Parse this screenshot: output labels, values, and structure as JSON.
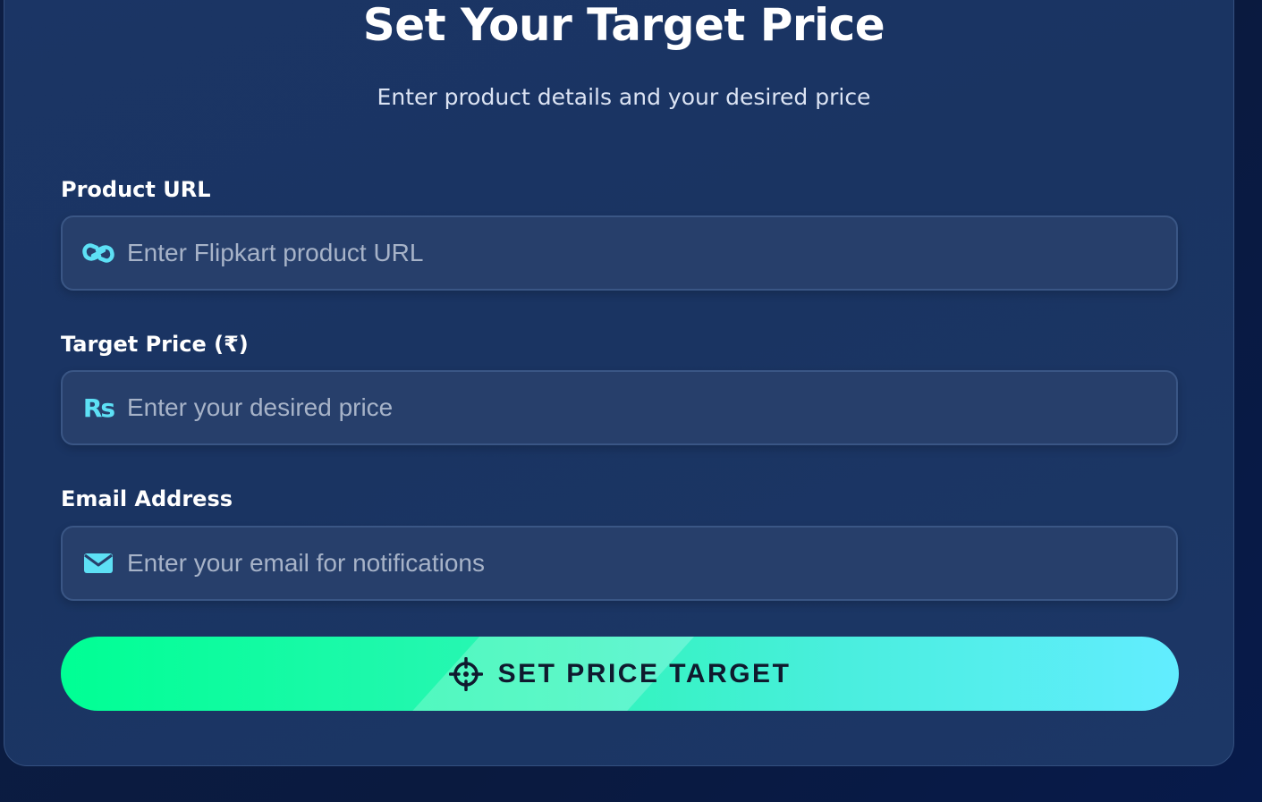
{
  "header": {
    "title": "Set Your Target Price",
    "subtitle": "Enter product details and your desired price"
  },
  "form": {
    "product_url": {
      "label": "Product URL",
      "placeholder": "Enter Flipkart product URL",
      "value": "",
      "icon": "link-icon"
    },
    "target_price": {
      "label": "Target Price (₹)",
      "placeholder": "Enter your desired price",
      "value": "",
      "icon": "rupee-icon",
      "icon_text": "Rs"
    },
    "email": {
      "label": "Email Address",
      "placeholder": "Enter your email for notifications",
      "value": "",
      "icon": "envelope-icon"
    },
    "submit": {
      "label": "SET PRICE TARGET",
      "icon": "crosshairs-icon"
    }
  },
  "colors": {
    "accent_green": "#00ff94",
    "accent_cyan": "#62edff",
    "icon_cyan": "#5de0f5",
    "card_bg": "#1b3565",
    "field_bg": "#273f6b"
  }
}
